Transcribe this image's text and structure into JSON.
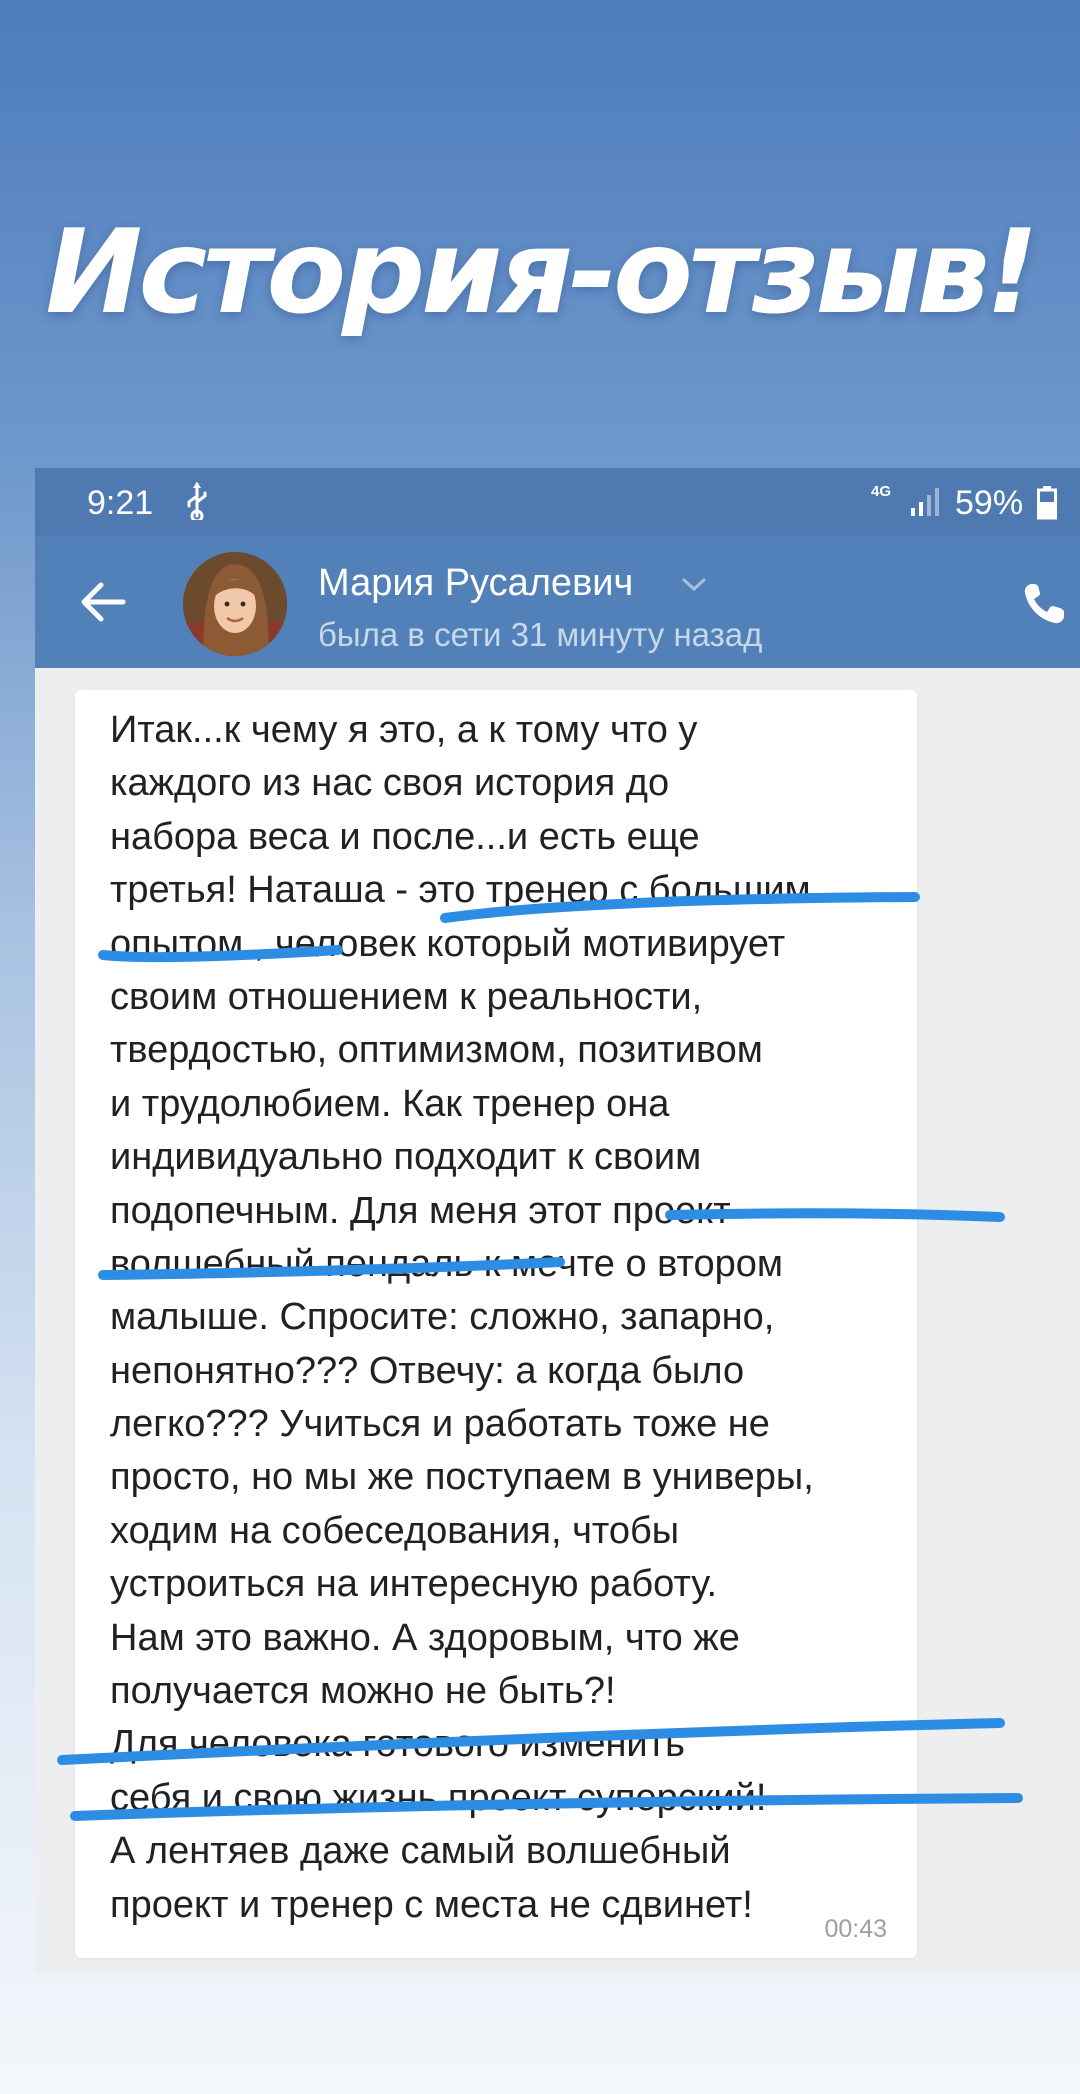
{
  "headline": "История-отзыв!",
  "status_bar": {
    "time": "9:21",
    "network": "4G",
    "battery": "59%"
  },
  "chat_header": {
    "contact_name": "Мария Русалевич",
    "contact_status": "была в сети 31 минуту назад"
  },
  "message": {
    "lines": [
      "Итак...к чему я это, а к тому что у",
      "каждого из нас своя история до",
      "набора веса и после...и есть еще",
      "третья! Наташа - это тренер с большим",
      "опытом , человек который мотивирует",
      "своим отношением к реальности,",
      "твердостью, оптимизмом, позитивом",
      "и трудолюбием. Как тренер она",
      "индивидуально подходит к своим",
      "подопечным. Для меня этот проект",
      "волшебный пендаль к мечте о втором",
      "малыше. Спросите: сложно, запарно,",
      "непонятно??? Отвечу: а когда было",
      "легко??? Учиться и работать тоже не",
      "просто, но мы же поступаем в универы,",
      "ходим на собеседования, чтобы",
      "устроиться на интересную работу.",
      "Нам это важно. А здоровым, что же",
      "получается можно не быть?!",
      "Для человека готового изменить",
      "себя и свою жизнь проект суперский!",
      "А лентяев даже самый волшебный",
      "проект и тренер с места не сдвинет!"
    ],
    "time": "00:43"
  },
  "icons": {
    "back": "arrow-left-icon",
    "usb": "usb-icon",
    "signal": "signal-bars-icon",
    "battery": "battery-icon",
    "chevron": "chevron-down-icon",
    "phone": "phone-icon"
  },
  "colors": {
    "header": "#5181b8",
    "status_bar": "#4f79b1",
    "highlight": "#2d8de4",
    "message_text": "#202124"
  }
}
